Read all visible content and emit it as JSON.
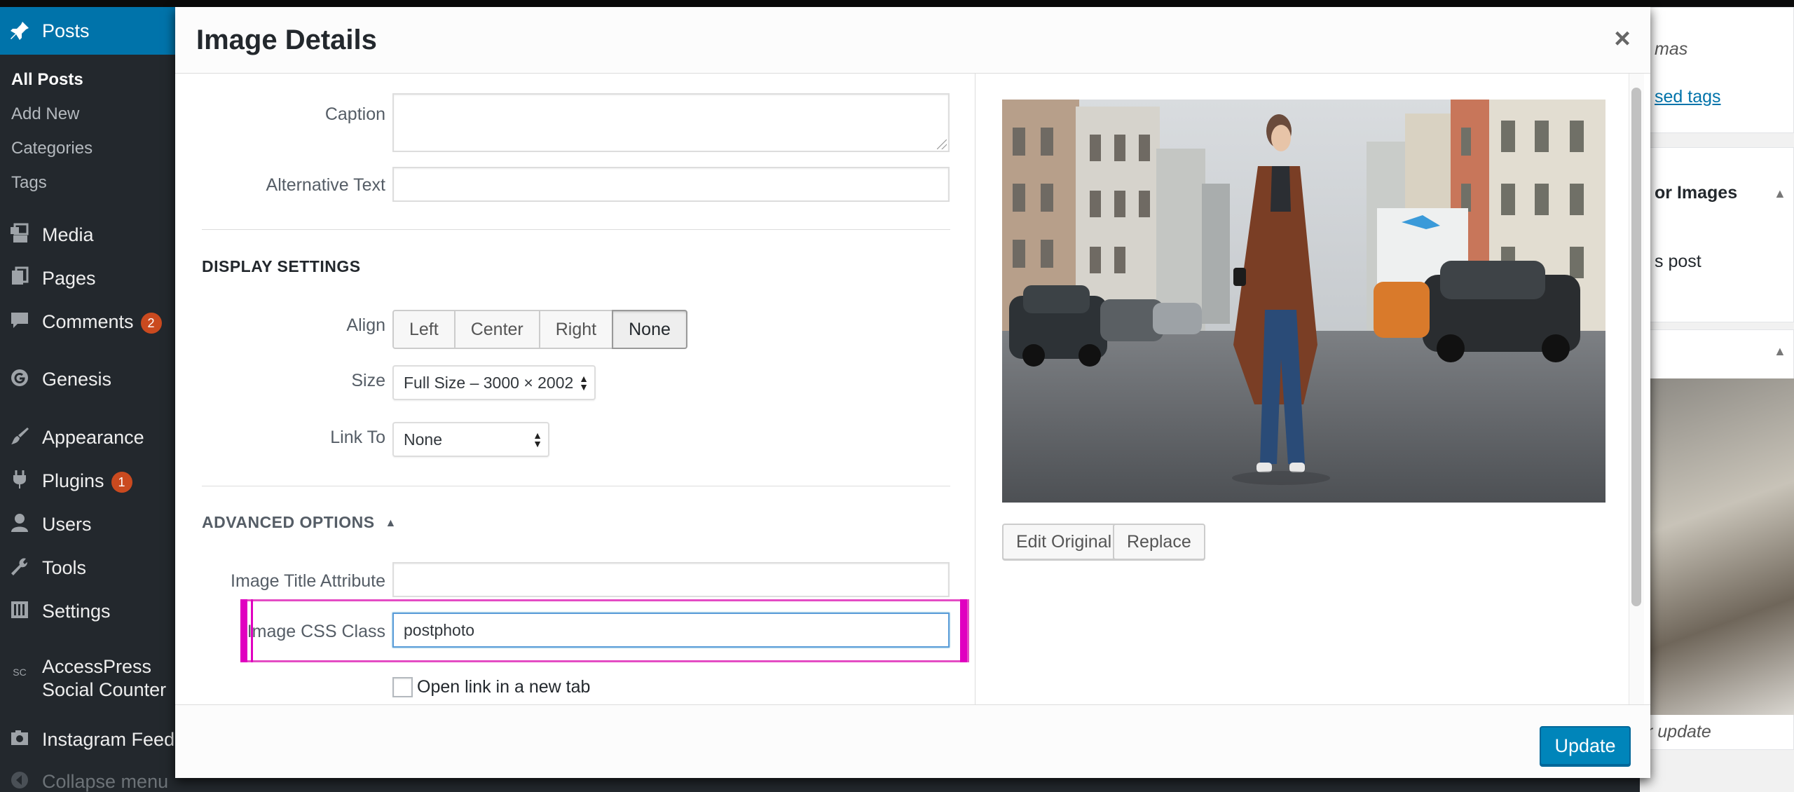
{
  "sidebar": {
    "posts_label": "Posts",
    "sub_items": [
      {
        "label": "All Posts"
      },
      {
        "label": "Add New"
      },
      {
        "label": "Categories"
      },
      {
        "label": "Tags"
      }
    ],
    "items": [
      {
        "label": "Media",
        "icon": "media-icon"
      },
      {
        "label": "Pages",
        "icon": "pages-icon"
      },
      {
        "label": "Comments",
        "icon": "comments-icon",
        "badge": "2"
      },
      {
        "label": "Genesis",
        "icon": "genesis-icon"
      },
      {
        "label": "Appearance",
        "icon": "appearance-icon"
      },
      {
        "label": "Plugins",
        "icon": "plugins-icon",
        "badge": "1"
      },
      {
        "label": "Users",
        "icon": "users-icon"
      },
      {
        "label": "Tools",
        "icon": "tools-icon"
      },
      {
        "label": "Settings",
        "icon": "settings-icon"
      },
      {
        "label": "AccessPress",
        "label2": "Social Counter",
        "icon": "accesspress-icon"
      },
      {
        "label": "Instagram Feed",
        "icon": "instagram-icon"
      },
      {
        "label": "Collapse menu",
        "icon": "collapse-icon"
      }
    ]
  },
  "right_panel": {
    "text1": "mas",
    "link1": "sed tags",
    "heading": "or Images",
    "text2": "s post",
    "text3": "r update"
  },
  "modal": {
    "title": "Image Details",
    "close_glyph": "×",
    "fields": {
      "caption_label": "Caption",
      "caption_value": "",
      "alt_label": "Alternative Text",
      "alt_value": ""
    },
    "display_settings": {
      "title": "DISPLAY SETTINGS",
      "align_label": "Align",
      "align_options": [
        "Left",
        "Center",
        "Right",
        "None"
      ],
      "align_selected": "None",
      "size_label": "Size",
      "size_value": "Full Size – 3000 × 2002",
      "link_label": "Link To",
      "link_value": "None"
    },
    "advanced": {
      "title": "ADVANCED OPTIONS",
      "toggle_glyph": "▲",
      "title_attr_label": "Image Title Attribute",
      "title_attr_value": "",
      "css_class_label": "Image CSS Class",
      "css_class_value": "postphoto",
      "new_tab_label": "Open link in a new tab",
      "new_tab_checked": false
    },
    "image_actions": {
      "edit_original": "Edit Original",
      "replace": "Replace"
    },
    "footer": {
      "update_label": "Update"
    }
  },
  "colors": {
    "admin_bg": "#23282d",
    "accent": "#0073aa",
    "primary_button": "#0085ba",
    "highlight": "#e000c0"
  }
}
